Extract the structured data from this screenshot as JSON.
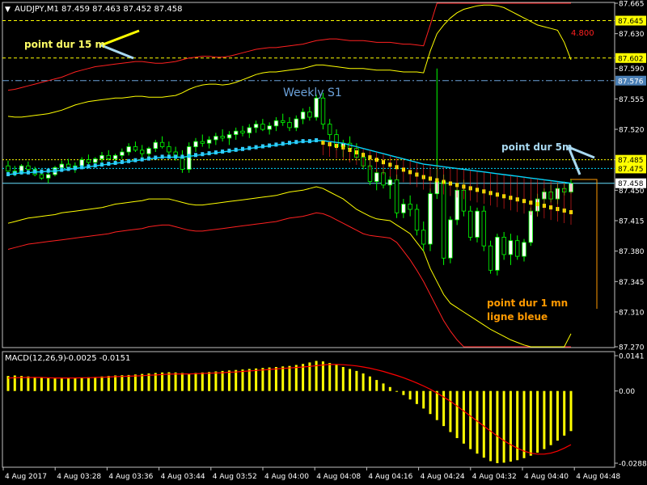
{
  "header": {
    "symbol": "AUDJPY,M1",
    "ohlc": "87.459 87.463 87.452 87.458"
  },
  "macd_header": {
    "title": "MACD(12,26,9)",
    "values": "-0.0025 -0.0151"
  },
  "annotations": {
    "point15": "point dur 15 m",
    "point5": "point dur 5m",
    "point1_line1": "point dur 1 mn",
    "point1_line2": "ligne bleue",
    "weekly": "Weekly S1",
    "red_value": "4.800"
  },
  "colors": {
    "background": "#000000",
    "bull_candle": "#ffffff",
    "bull_outline": "#00ff00",
    "bear_candle": "#000000",
    "wick": "#00ff00",
    "bollinger_outer": "#ff2020",
    "bollinger_inner": "#ffff00",
    "ma_cyan": "#00d8ff",
    "macd_hist": "#ffff00",
    "macd_signal": "#ff0000",
    "annotation": "#ffff66",
    "weekly_line": "#6aa0d8"
  },
  "chart_data": {
    "type": "candlestick",
    "price_axis": {
      "ylim": [
        87.27,
        87.665
      ],
      "ticks": [
        "87.665",
        "87.630",
        "87.590",
        "87.555",
        "87.520",
        "87.485",
        "87.450",
        "87.415",
        "87.380",
        "87.345",
        "87.310",
        "87.270"
      ],
      "price_tags": [
        {
          "label": "87.645",
          "value": 87.645,
          "style": "yellow"
        },
        {
          "label": "87.602",
          "value": 87.602,
          "style": "yellow"
        },
        {
          "label": "87.576",
          "value": 87.576,
          "style": "blue"
        },
        {
          "label": "87.485",
          "value": 87.485,
          "style": "yellow"
        },
        {
          "label": "87.475",
          "value": 87.475,
          "style": "yellow"
        },
        {
          "label": "87.458",
          "value": 87.458,
          "style": "white"
        }
      ]
    },
    "levels": [
      {
        "value": 87.645,
        "style": "yellow-dashed"
      },
      {
        "value": 87.602,
        "style": "yellow-dashed"
      },
      {
        "value": 87.576,
        "style": "blue-dashdot"
      },
      {
        "value": 87.485,
        "style": "yellow-dotted"
      },
      {
        "value": 87.475,
        "style": "cyan-dotted"
      },
      {
        "value": 87.458,
        "style": "cyan-solid"
      }
    ],
    "time_axis": [
      "4 Aug 2017",
      "4 Aug 03:28",
      "4 Aug 03:36",
      "4 Aug 03:44",
      "4 Aug 03:52",
      "4 Aug 04:00",
      "4 Aug 04:08",
      "4 Aug 04:16",
      "4 Aug 04:24",
      "4 Aug 04:32",
      "4 Aug 04:40",
      "4 Aug 04:48"
    ],
    "candles": [
      [
        87.478,
        87.484,
        87.47,
        87.472
      ],
      [
        87.472,
        87.478,
        87.466,
        87.47
      ],
      [
        87.47,
        87.48,
        87.468,
        87.478
      ],
      [
        87.478,
        87.483,
        87.472,
        87.474
      ],
      [
        87.474,
        87.477,
        87.466,
        87.468
      ],
      [
        87.468,
        87.474,
        87.462,
        87.464
      ],
      [
        87.464,
        87.47,
        87.458,
        87.468
      ],
      [
        87.468,
        87.478,
        87.466,
        87.476
      ],
      [
        87.476,
        87.484,
        87.472,
        87.48
      ],
      [
        87.48,
        87.486,
        87.474,
        87.476
      ],
      [
        87.476,
        87.482,
        87.47,
        87.478
      ],
      [
        87.478,
        87.488,
        87.476,
        87.485
      ],
      [
        87.485,
        87.491,
        87.48,
        87.482
      ],
      [
        87.482,
        87.488,
        87.476,
        87.486
      ],
      [
        87.486,
        87.494,
        87.482,
        87.49
      ],
      [
        87.49,
        87.496,
        87.484,
        87.486
      ],
      [
        87.486,
        87.492,
        87.48,
        87.49
      ],
      [
        87.49,
        87.498,
        87.486,
        87.494
      ],
      [
        87.494,
        87.504,
        87.49,
        87.5
      ],
      [
        87.5,
        87.506,
        87.494,
        87.496
      ],
      [
        87.496,
        87.502,
        87.488,
        87.492
      ],
      [
        87.492,
        87.5,
        87.486,
        87.498
      ],
      [
        87.498,
        87.508,
        87.494,
        87.505
      ],
      [
        87.505,
        87.512,
        87.498,
        87.5
      ],
      [
        87.5,
        87.506,
        87.49,
        87.494
      ],
      [
        87.494,
        87.5,
        87.484,
        87.488
      ],
      [
        87.488,
        87.496,
        87.47,
        87.474
      ],
      [
        87.474,
        87.505,
        87.47,
        87.5
      ],
      [
        87.5,
        87.51,
        87.494,
        87.506
      ],
      [
        87.506,
        87.514,
        87.5,
        87.504
      ],
      [
        87.504,
        87.512,
        87.498,
        87.508
      ],
      [
        87.508,
        87.516,
        87.502,
        87.512
      ],
      [
        87.512,
        87.52,
        87.506,
        87.51
      ],
      [
        87.51,
        87.518,
        87.502,
        87.514
      ],
      [
        87.514,
        87.522,
        87.508,
        87.518
      ],
      [
        87.518,
        87.524,
        87.512,
        87.516
      ],
      [
        87.516,
        87.526,
        87.51,
        87.522
      ],
      [
        87.522,
        87.53,
        87.516,
        87.526
      ],
      [
        87.526,
        87.532,
        87.518,
        87.52
      ],
      [
        87.52,
        87.528,
        87.514,
        87.524
      ],
      [
        87.524,
        87.534,
        87.518,
        87.53
      ],
      [
        87.53,
        87.538,
        87.524,
        87.528
      ],
      [
        87.528,
        87.534,
        87.518,
        87.522
      ],
      [
        87.522,
        87.536,
        87.518,
        87.532
      ],
      [
        87.532,
        87.544,
        87.526,
        87.54
      ],
      [
        87.54,
        87.546,
        87.53,
        87.534
      ],
      [
        87.534,
        87.56,
        87.53,
        87.556
      ],
      [
        87.556,
        87.562,
        87.52,
        87.526
      ],
      [
        87.526,
        87.532,
        87.508,
        87.514
      ],
      [
        87.514,
        87.52,
        87.496,
        87.5
      ],
      [
        87.5,
        87.508,
        87.488,
        87.504
      ],
      [
        87.504,
        87.512,
        87.496,
        87.498
      ],
      [
        87.498,
        87.504,
        87.484,
        87.488
      ],
      [
        87.488,
        87.494,
        87.474,
        87.478
      ],
      [
        87.478,
        87.486,
        87.456,
        87.46
      ],
      [
        87.46,
        87.474,
        87.45,
        87.47
      ],
      [
        87.47,
        87.476,
        87.452,
        87.456
      ],
      [
        87.456,
        87.466,
        87.44,
        87.462
      ],
      [
        87.462,
        87.468,
        87.418,
        87.424
      ],
      [
        87.424,
        87.44,
        87.418,
        87.434
      ],
      [
        87.434,
        87.444,
        87.42,
        87.428
      ],
      [
        87.428,
        87.434,
        87.398,
        87.404
      ],
      [
        87.404,
        87.414,
        87.38,
        87.388
      ],
      [
        87.388,
        87.452,
        87.38,
        87.446
      ],
      [
        87.446,
        87.59,
        87.44,
        87.46
      ],
      [
        87.46,
        87.468,
        87.364,
        87.372
      ],
      [
        87.372,
        87.42,
        87.366,
        87.416
      ],
      [
        87.416,
        87.454,
        87.41,
        87.45
      ],
      [
        87.45,
        87.462,
        87.42,
        87.426
      ],
      [
        87.426,
        87.432,
        87.392,
        87.396
      ],
      [
        87.396,
        87.43,
        87.39,
        87.426
      ],
      [
        87.426,
        87.432,
        87.38,
        87.386
      ],
      [
        87.386,
        87.392,
        87.354,
        87.358
      ],
      [
        87.358,
        87.4,
        87.352,
        87.396
      ],
      [
        87.396,
        87.402,
        87.37,
        87.376
      ],
      [
        87.376,
        87.4,
        87.364,
        87.392
      ],
      [
        87.392,
        87.398,
        87.37,
        87.374
      ],
      [
        87.374,
        87.394,
        87.368,
        87.39
      ],
      [
        87.39,
        87.43,
        87.386,
        87.426
      ],
      [
        87.426,
        87.446,
        87.42,
        87.44
      ],
      [
        87.44,
        87.452,
        87.432,
        87.448
      ],
      [
        87.448,
        87.456,
        87.436,
        87.44
      ],
      [
        87.44,
        87.458,
        87.434,
        87.452
      ],
      [
        87.452,
        87.46,
        87.444,
        87.448
      ],
      [
        87.448,
        87.463,
        87.446,
        87.458
      ]
    ],
    "ma_cyan": [
      87.468,
      87.469,
      87.47,
      87.47,
      87.471,
      87.471,
      87.472,
      87.472,
      87.473,
      87.474,
      87.475,
      87.476,
      87.477,
      87.478,
      87.479,
      87.48,
      87.481,
      87.482,
      87.483,
      87.484,
      87.485,
      87.486,
      87.487,
      87.488,
      87.488,
      87.488,
      87.488,
      87.489,
      87.49,
      87.491,
      87.492,
      87.493,
      87.494,
      87.495,
      87.496,
      87.497,
      87.498,
      87.499,
      87.5,
      87.501,
      87.502,
      87.503,
      87.504,
      87.505,
      87.506,
      87.506,
      87.507,
      87.507,
      87.506,
      87.505,
      87.504,
      87.502,
      87.5,
      87.498,
      87.496,
      87.494,
      87.492,
      87.49,
      87.488,
      87.486,
      87.484,
      87.482,
      87.48,
      87.479,
      87.478,
      87.477,
      87.476,
      87.475,
      87.474,
      87.473,
      87.472,
      87.471,
      87.47,
      87.469,
      87.468,
      87.467,
      87.466,
      87.465,
      87.464,
      87.463,
      87.462,
      87.461,
      87.46,
      87.459,
      87.458
    ],
    "bb_outer_upper": [
      87.565,
      87.566,
      87.568,
      87.57,
      87.572,
      87.574,
      87.576,
      87.578,
      87.58,
      87.583,
      87.586,
      87.588,
      87.59,
      87.592,
      87.593,
      87.594,
      87.595,
      87.596,
      87.597,
      87.598,
      87.598,
      87.597,
      87.596,
      87.596,
      87.597,
      87.598,
      87.6,
      87.602,
      87.603,
      87.604,
      87.604,
      87.603,
      87.603,
      87.604,
      87.606,
      87.608,
      87.61,
      87.612,
      87.613,
      87.614,
      87.614,
      87.615,
      87.616,
      87.617,
      87.618,
      87.62,
      87.622,
      87.623,
      87.624,
      87.624,
      87.623,
      87.622,
      87.622,
      87.622,
      87.621,
      87.62,
      87.62,
      87.62,
      87.619,
      87.618,
      87.618,
      87.617,
      87.616,
      87.64,
      87.665,
      87.665,
      87.665,
      87.665,
      87.665,
      87.665,
      87.665,
      87.665,
      87.665,
      87.665,
      87.665,
      87.665,
      87.665,
      87.665,
      87.665,
      87.665,
      87.665,
      87.665,
      87.665,
      87.665,
      87.665
    ],
    "bb_inner_upper": [
      87.535,
      87.534,
      87.534,
      87.535,
      87.536,
      87.537,
      87.538,
      87.54,
      87.542,
      87.545,
      87.548,
      87.55,
      87.552,
      87.553,
      87.554,
      87.555,
      87.556,
      87.556,
      87.557,
      87.558,
      87.558,
      87.557,
      87.557,
      87.557,
      87.558,
      87.559,
      87.562,
      87.566,
      87.569,
      87.571,
      87.572,
      87.572,
      87.571,
      87.572,
      87.574,
      87.577,
      87.58,
      87.583,
      87.585,
      87.586,
      87.586,
      87.587,
      87.588,
      87.589,
      87.59,
      87.592,
      87.594,
      87.594,
      87.593,
      87.592,
      87.591,
      87.59,
      87.59,
      87.59,
      87.589,
      87.588,
      87.588,
      87.588,
      87.587,
      87.586,
      87.586,
      87.586,
      87.585,
      87.61,
      87.63,
      87.64,
      87.648,
      87.654,
      87.658,
      87.66,
      87.662,
      87.663,
      87.663,
      87.662,
      87.66,
      87.656,
      87.652,
      87.648,
      87.644,
      87.64,
      87.638,
      87.636,
      87.634,
      87.62,
      87.6
    ],
    "bb_inner_lower": [
      87.412,
      87.414,
      87.416,
      87.418,
      87.419,
      87.42,
      87.421,
      87.422,
      87.424,
      87.425,
      87.426,
      87.427,
      87.428,
      87.429,
      87.43,
      87.432,
      87.434,
      87.435,
      87.436,
      87.437,
      87.438,
      87.44,
      87.44,
      87.44,
      87.44,
      87.438,
      87.436,
      87.434,
      87.433,
      87.433,
      87.434,
      87.435,
      87.436,
      87.437,
      87.438,
      87.439,
      87.44,
      87.441,
      87.442,
      87.443,
      87.444,
      87.446,
      87.448,
      87.449,
      87.45,
      87.452,
      87.454,
      87.452,
      87.448,
      87.444,
      87.44,
      87.434,
      87.428,
      87.424,
      87.42,
      87.417,
      87.416,
      87.415,
      87.41,
      87.405,
      87.4,
      87.39,
      87.38,
      87.36,
      87.345,
      87.33,
      87.32,
      87.315,
      87.31,
      87.305,
      87.3,
      87.295,
      87.29,
      87.286,
      87.282,
      87.278,
      87.275,
      87.272,
      87.27,
      87.27,
      87.27,
      87.27,
      87.27,
      87.27,
      87.285
    ],
    "bb_outer_lower": [
      87.382,
      87.384,
      87.386,
      87.388,
      87.389,
      87.39,
      87.391,
      87.392,
      87.393,
      87.394,
      87.395,
      87.396,
      87.397,
      87.398,
      87.399,
      87.4,
      87.402,
      87.403,
      87.404,
      87.405,
      87.406,
      87.408,
      87.409,
      87.41,
      87.41,
      87.408,
      87.406,
      87.404,
      87.403,
      87.403,
      87.404,
      87.405,
      87.406,
      87.407,
      87.408,
      87.409,
      87.41,
      87.411,
      87.412,
      87.413,
      87.414,
      87.416,
      87.418,
      87.419,
      87.42,
      87.422,
      87.424,
      87.423,
      87.42,
      87.416,
      87.412,
      87.408,
      87.404,
      87.4,
      87.398,
      87.397,
      87.396,
      87.395,
      87.39,
      87.38,
      87.37,
      87.358,
      87.345,
      87.33,
      87.315,
      87.3,
      87.288,
      87.278,
      87.27,
      87.27,
      87.27,
      87.27,
      87.27,
      87.27,
      87.27,
      87.27,
      87.27,
      87.27,
      87.27,
      87.27,
      87.27,
      87.27,
      87.27,
      87.27,
      87.27
    ],
    "macd_axis": {
      "ticks": [
        "0.0141",
        "0.00",
        "-0.0288"
      ],
      "ylim": [
        -0.0288,
        0.0141
      ]
    },
    "macd_hist": [
      0.006,
      0.0062,
      0.006,
      0.0058,
      0.0056,
      0.0054,
      0.0052,
      0.005,
      0.005,
      0.0051,
      0.0052,
      0.0054,
      0.0055,
      0.0056,
      0.0058,
      0.006,
      0.0062,
      0.0063,
      0.0064,
      0.0066,
      0.0068,
      0.007,
      0.0072,
      0.0074,
      0.0075,
      0.0074,
      0.0072,
      0.007,
      0.0072,
      0.0074,
      0.0076,
      0.0078,
      0.008,
      0.0082,
      0.0084,
      0.0086,
      0.0088,
      0.009,
      0.0092,
      0.0094,
      0.0096,
      0.0098,
      0.01,
      0.0104,
      0.0108,
      0.0114,
      0.012,
      0.0118,
      0.0112,
      0.0104,
      0.0096,
      0.0088,
      0.008,
      0.007,
      0.0058,
      0.0044,
      0.003,
      0.0016,
      0.0,
      -0.0016,
      -0.0034,
      -0.0052,
      -0.007,
      -0.0092,
      -0.0116,
      -0.014,
      -0.0164,
      -0.0188,
      -0.021,
      -0.0232,
      -0.025,
      -0.0266,
      -0.028,
      -0.0288,
      -0.0286,
      -0.0282,
      -0.0276,
      -0.0268,
      -0.0258,
      -0.0246,
      -0.0232,
      -0.0216,
      -0.0198,
      -0.0178,
      -0.016
    ],
    "macd_signal": [
      0.0052,
      0.0053,
      0.0054,
      0.0054,
      0.0054,
      0.0054,
      0.0053,
      0.0052,
      0.0052,
      0.0052,
      0.0052,
      0.0053,
      0.0053,
      0.0054,
      0.0055,
      0.0056,
      0.0057,
      0.0058,
      0.0059,
      0.006,
      0.0061,
      0.0063,
      0.0064,
      0.0066,
      0.0067,
      0.0068,
      0.0068,
      0.0068,
      0.0069,
      0.007,
      0.0071,
      0.0072,
      0.0073,
      0.0075,
      0.0076,
      0.0078,
      0.008,
      0.0082,
      0.0084,
      0.0086,
      0.0088,
      0.009,
      0.0092,
      0.0094,
      0.0096,
      0.0098,
      0.0101,
      0.0104,
      0.0106,
      0.0106,
      0.0105,
      0.0103,
      0.01,
      0.0096,
      0.0091,
      0.0085,
      0.0078,
      0.007,
      0.0062,
      0.0053,
      0.0043,
      0.0032,
      0.002,
      0.0007,
      -0.0008,
      -0.0024,
      -0.0041,
      -0.006,
      -0.008,
      -0.01,
      -0.012,
      -0.014,
      -0.016,
      -0.018,
      -0.0198,
      -0.0214,
      -0.0228,
      -0.024,
      -0.0248,
      -0.0252,
      -0.0252,
      -0.0248,
      -0.024,
      -0.0228,
      -0.0214
    ]
  }
}
